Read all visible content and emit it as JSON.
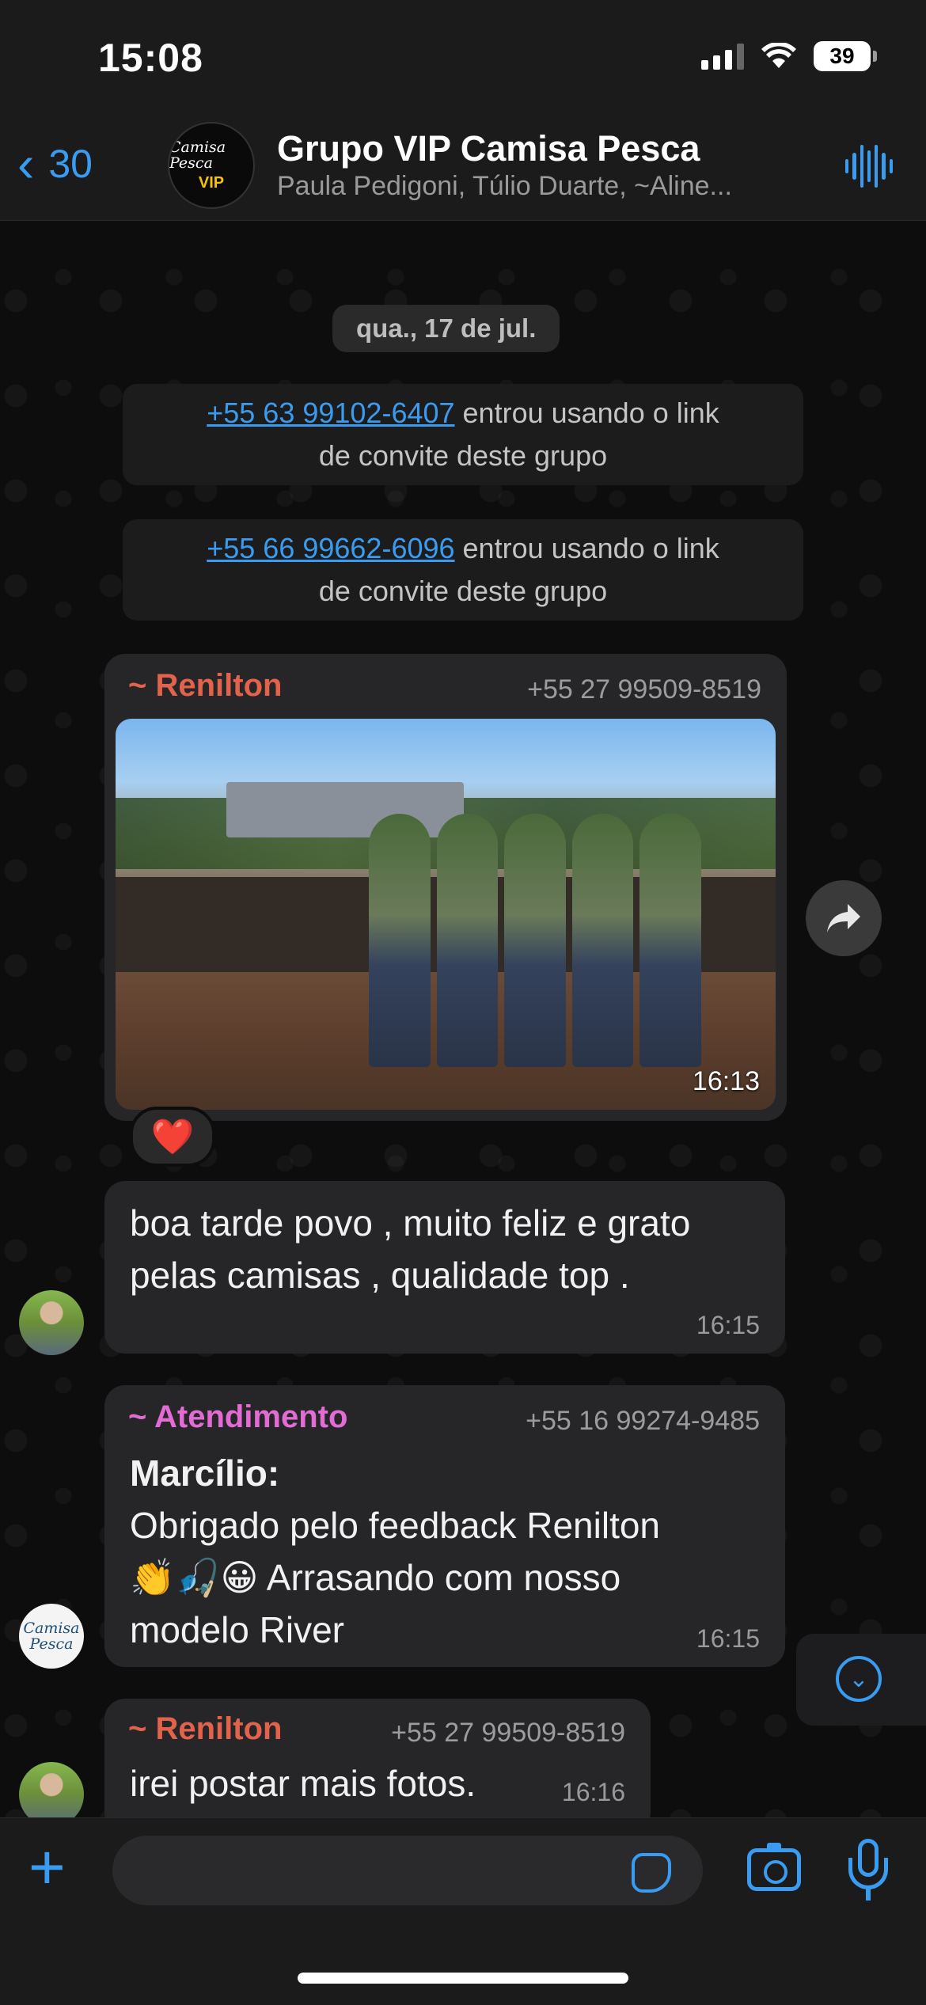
{
  "status": {
    "time": "15:08",
    "battery": "39"
  },
  "header": {
    "back_count": "30",
    "title": "Grupo VIP Camisa Pesca",
    "subtitle": "Paula Pedigoni, Túlio Duarte, ~Aline...",
    "avatar_text": "Camisa Pesca",
    "avatar_badge": "VIP"
  },
  "chat": {
    "date": "qua., 17 de jul.",
    "system": [
      {
        "phone": "+55 63 99102-6407",
        "text": " entrou usando o link",
        "text2": "de convite deste grupo"
      },
      {
        "phone": "+55 66 99662-6096",
        "text": " entrou usando o link",
        "text2": "de convite deste grupo"
      }
    ],
    "messages": [
      {
        "sender": "~ Renilton",
        "phone": "+55 27 99509-8519",
        "image_time": "16:13",
        "reaction": "❤️"
      },
      {
        "text_line1": "boa tarde povo , muito feliz e grato",
        "text_line2": "pelas camisas , qualidade top .",
        "time": "16:15"
      },
      {
        "sender": "~ Atendimento",
        "phone": "+55 16 99274-9485",
        "bold": "Marcílio:",
        "line1": "Obrigado pelo feedback Renilton",
        "emojis": "👏🎣😀",
        "line2": " Arrasando com nosso",
        "line3": "modelo River",
        "time": "16:15",
        "avatar_text": "Camisa Pesca"
      },
      {
        "sender": "~ Renilton",
        "phone": "+55 27 99509-8519",
        "text": "irei postar mais fotos.",
        "time": "16:16"
      }
    ]
  },
  "composer": {
    "placeholder": ""
  },
  "colors": {
    "accent": "#3a9cf0",
    "sender_red": "#e3624b",
    "sender_pink": "#e26bd4",
    "bubble": "#262628"
  }
}
